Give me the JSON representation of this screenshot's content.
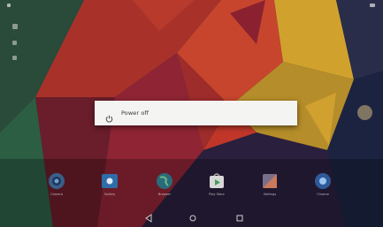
{
  "power_menu": {
    "items": [
      {
        "icon": "power-icon",
        "label": "Power off"
      }
    ]
  },
  "apps": [
    {
      "name": "Camera",
      "icon": "camera-icon"
    },
    {
      "name": "Gallery",
      "icon": "gallery-icon"
    },
    {
      "name": "Browser",
      "icon": "globe-icon"
    },
    {
      "name": "Play Store",
      "icon": "store-icon"
    },
    {
      "name": "Settings",
      "icon": "settings-icon"
    },
    {
      "name": "Chrome",
      "icon": "chrome-icon"
    }
  ],
  "nav": {
    "buttons": [
      "back-icon",
      "home-icon",
      "recents-icon"
    ]
  },
  "colors": {
    "dialog_bg": "#f4f4f2",
    "wallpaper_red": "#b52a26",
    "wallpaper_navy": "#12203a",
    "wallpaper_gold": "#c99a25"
  }
}
